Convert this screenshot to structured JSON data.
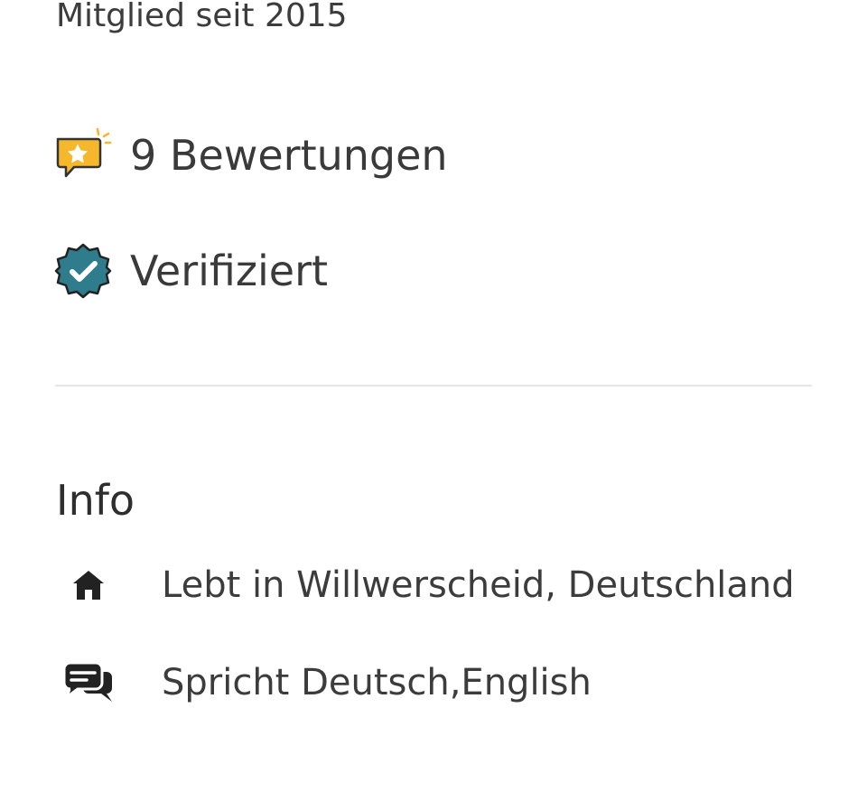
{
  "profile": {
    "member_since": "Mitglied seit 2015"
  },
  "stats": {
    "reviews": {
      "label": "9 Bewertungen",
      "icon": "review-star-bubble-icon"
    },
    "verified": {
      "label": "Verifiziert",
      "icon": "verified-badge-icon"
    }
  },
  "info": {
    "heading": "Info",
    "location": {
      "label": "Lebt in Willwerscheid, Deutschland",
      "icon": "home-icon"
    },
    "languages": {
      "label": "Spricht Deutsch,English",
      "icon": "speech-bubbles-icon"
    }
  },
  "colors": {
    "review_icon": "#f5b72b",
    "verified_icon": "#2f7c8c",
    "text": "#3c3c3c",
    "divider": "#e6e6e6"
  }
}
